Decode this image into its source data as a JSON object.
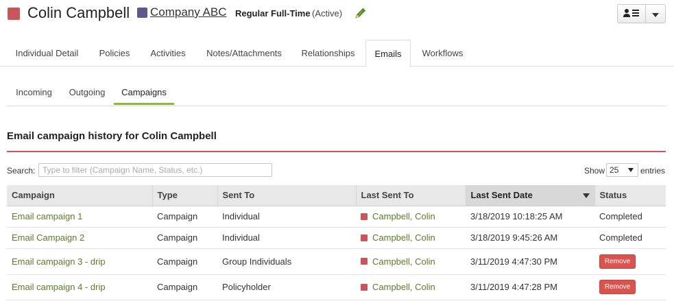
{
  "header": {
    "person_name": "Colin Campbell",
    "person_color": "#c9565b",
    "company_name": "Company ABC",
    "company_color": "#5c5a8c",
    "employment_type": "Regular Full-Time",
    "employment_status": "(Active)",
    "edit_icon": "pencil-icon",
    "actions_icon": "person-list-icon",
    "dropdown_icon": "caret-down-icon"
  },
  "main_tabs": [
    {
      "label": "Individual Detail",
      "active": false
    },
    {
      "label": "Policies",
      "active": false
    },
    {
      "label": "Activities",
      "active": false
    },
    {
      "label": "Notes/Attachments",
      "active": false
    },
    {
      "label": "Relationships",
      "active": false
    },
    {
      "label": "Emails",
      "active": true
    },
    {
      "label": "Workflows",
      "active": false
    }
  ],
  "sub_tabs": [
    {
      "label": "Incoming",
      "active": false
    },
    {
      "label": "Outgoing",
      "active": false
    },
    {
      "label": "Campaigns",
      "active": true
    }
  ],
  "section": {
    "title": "Email campaign history for Colin Campbell",
    "accent_color": "#c9565b"
  },
  "filter": {
    "search_label": "Search:",
    "search_value": "",
    "search_placeholder": "Type to filter (Campaign Name, Status, etc.)",
    "show_label": "Show",
    "page_size": "25",
    "entries_label": "entries"
  },
  "table": {
    "columns": [
      "Campaign",
      "Type",
      "Sent To",
      "Last Sent To",
      "Last Sent Date",
      "Status"
    ],
    "sorted_column": "Last Sent Date",
    "sort_direction": "descending",
    "rows": [
      {
        "campaign": "Email campaign 1",
        "type": "Campaign",
        "sent_to": "Individual",
        "last_sent_to": "Campbell, Colin",
        "last_sent_date": "3/18/2019 10:18:25 AM",
        "status": "Completed",
        "action": ""
      },
      {
        "campaign": "Email Campaign 2",
        "type": "Campaign",
        "sent_to": "Individual",
        "last_sent_to": "Campbell, Colin",
        "last_sent_date": "3/18/2019 9:45:26 AM",
        "status": "Completed",
        "action": ""
      },
      {
        "campaign": "Email campaign 3 - drip",
        "type": "Campaign",
        "sent_to": "Group Individuals",
        "last_sent_to": "Campbell, Colin",
        "last_sent_date": "3/11/2019 4:47:30 PM",
        "status": "",
        "action": "Remove"
      },
      {
        "campaign": "Email campaign 4 - drip",
        "type": "Campaign",
        "sent_to": "Policyholder",
        "last_sent_to": "Campbell, Colin",
        "last_sent_date": "3/11/2019 4:47:28 PM",
        "status": "",
        "action": "Remove"
      }
    ]
  },
  "colors": {
    "link": "#5e7a2b",
    "active_subtab_underline": "#8cb83a",
    "remove_button": "#d9534f"
  }
}
